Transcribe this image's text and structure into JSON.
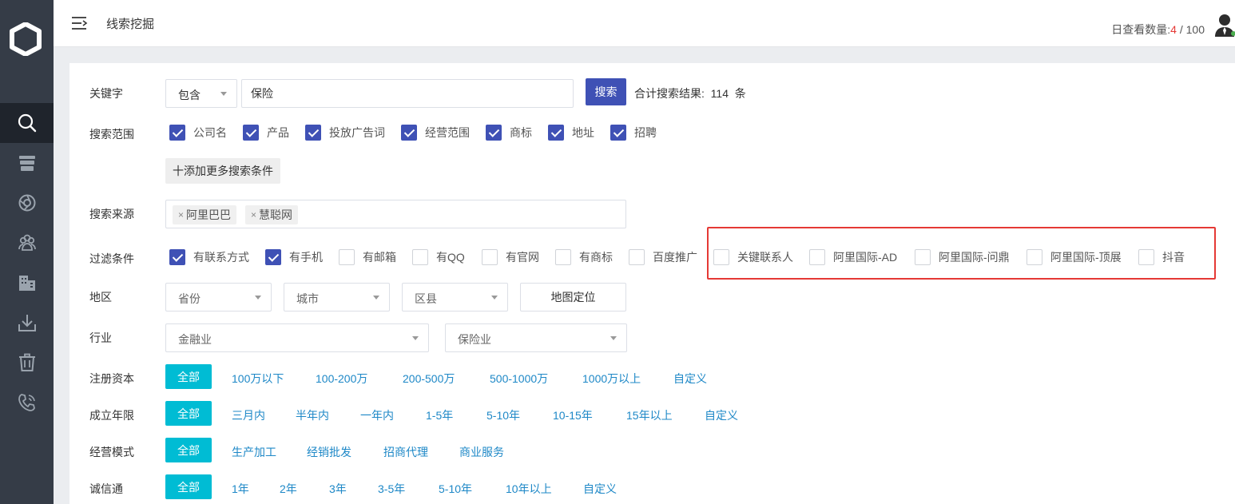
{
  "header": {
    "page_title": "线索挖掘",
    "quota_label": "日查看数量:",
    "quota_used": "4",
    "quota_sep": " / ",
    "quota_total": "100"
  },
  "sidebar": {
    "items": [
      {
        "icon": "search-icon",
        "active": true
      },
      {
        "icon": "database-icon",
        "active": false
      },
      {
        "icon": "aperture-icon",
        "active": false
      },
      {
        "icon": "users-icon",
        "active": false
      },
      {
        "icon": "building-icon",
        "active": false
      },
      {
        "icon": "download-icon",
        "active": false
      },
      {
        "icon": "trash-icon",
        "active": false
      },
      {
        "icon": "phone-icon",
        "active": false
      }
    ]
  },
  "keyword": {
    "label": "关键字",
    "mode": "包含",
    "value": "保险",
    "search_button": "搜索",
    "result_prefix": "合计搜索结果:",
    "result_count": "114",
    "result_suffix": "条"
  },
  "scope": {
    "label": "搜索范围",
    "options": [
      {
        "label": "公司名",
        "checked": true
      },
      {
        "label": "产品",
        "checked": true
      },
      {
        "label": "投放广告词",
        "checked": true
      },
      {
        "label": "经营范围",
        "checked": true
      },
      {
        "label": "商标",
        "checked": true
      },
      {
        "label": "地址",
        "checked": true
      },
      {
        "label": "招聘",
        "checked": true
      }
    ],
    "add_more": "十添加更多搜索条件"
  },
  "source": {
    "label": "搜索来源",
    "tags": [
      "阿里巴巴",
      "慧聪网"
    ]
  },
  "filter": {
    "label": "过滤条件",
    "options": [
      {
        "label": "有联系方式",
        "checked": true
      },
      {
        "label": "有手机",
        "checked": true
      },
      {
        "label": "有邮箱",
        "checked": false
      },
      {
        "label": "有QQ",
        "checked": false
      },
      {
        "label": "有官网",
        "checked": false
      },
      {
        "label": "有商标",
        "checked": false
      },
      {
        "label": "百度推广",
        "checked": false
      },
      {
        "label": "关键联系人",
        "checked": false
      },
      {
        "label": "阿里国际-AD",
        "checked": false
      },
      {
        "label": "阿里国际-问鼎",
        "checked": false
      },
      {
        "label": "阿里国际-顶展",
        "checked": false
      },
      {
        "label": "抖音",
        "checked": false
      }
    ]
  },
  "region": {
    "label": "地区",
    "province": "省份",
    "city": "城市",
    "district": "区县",
    "map_button": "地图定位"
  },
  "industry": {
    "label": "行业",
    "primary": "金融业",
    "secondary": "保险业"
  },
  "capital": {
    "label": "注册资本",
    "options": [
      "全部",
      "100万以下",
      "100-200万",
      "200-500万",
      "500-1000万",
      "1000万以上",
      "自定义"
    ]
  },
  "age": {
    "label": "成立年限",
    "options": [
      "全部",
      "三月内",
      "半年内",
      "一年内",
      "1-5年",
      "5-10年",
      "10-15年",
      "15年以上",
      "自定义"
    ]
  },
  "mode": {
    "label": "经营模式",
    "options": [
      "全部",
      "生产加工",
      "经销批发",
      "招商代理",
      "商业服务"
    ]
  },
  "credit": {
    "label": "诚信通",
    "options": [
      "全部",
      "1年",
      "2年",
      "3年",
      "3-5年",
      "5-10年",
      "10年以上",
      "自定义"
    ]
  },
  "colors": {
    "primary": "#3f51b5",
    "active_option": "#00bcd4",
    "link": "#1e88c7",
    "highlight": "#e53935",
    "sidebar": "#353c47"
  }
}
